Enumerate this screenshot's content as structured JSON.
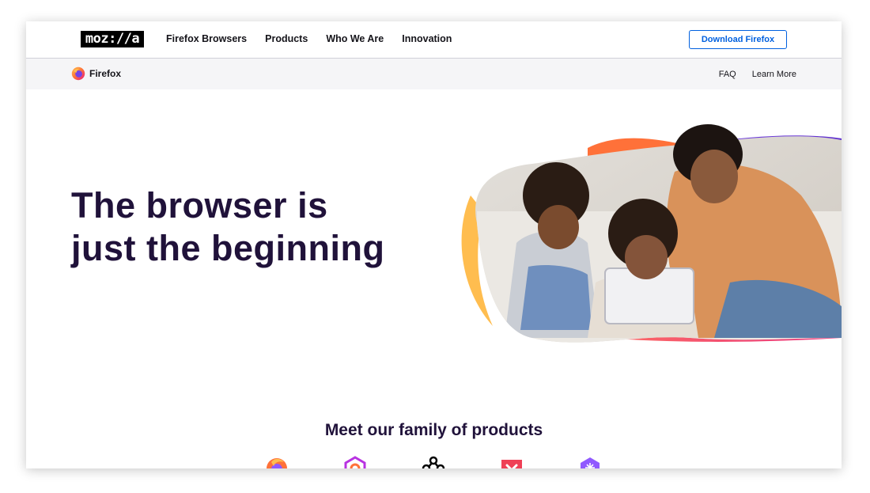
{
  "nav": {
    "logo_text": "moz://a",
    "links": [
      "Firefox Browsers",
      "Products",
      "Who We Are",
      "Innovation"
    ],
    "download_label": "Download Firefox"
  },
  "subnav": {
    "brand_label": "Firefox",
    "links": [
      "FAQ",
      "Learn More"
    ]
  },
  "hero": {
    "title_line1": "The browser is",
    "title_line2": "just the beginning"
  },
  "products": {
    "heading": "Meet our family of products",
    "icons": [
      "firefox-browser-icon",
      "firefox-monitor-icon",
      "mozilla-vpn-icon",
      "pocket-icon",
      "firefox-relay-icon"
    ]
  },
  "colors": {
    "title": "#20123a",
    "link_blue": "#0060df",
    "purple": "#7542e5",
    "orange": "#ff7139",
    "yellow": "#ffbd4f",
    "pink": "#ff4aa2"
  }
}
